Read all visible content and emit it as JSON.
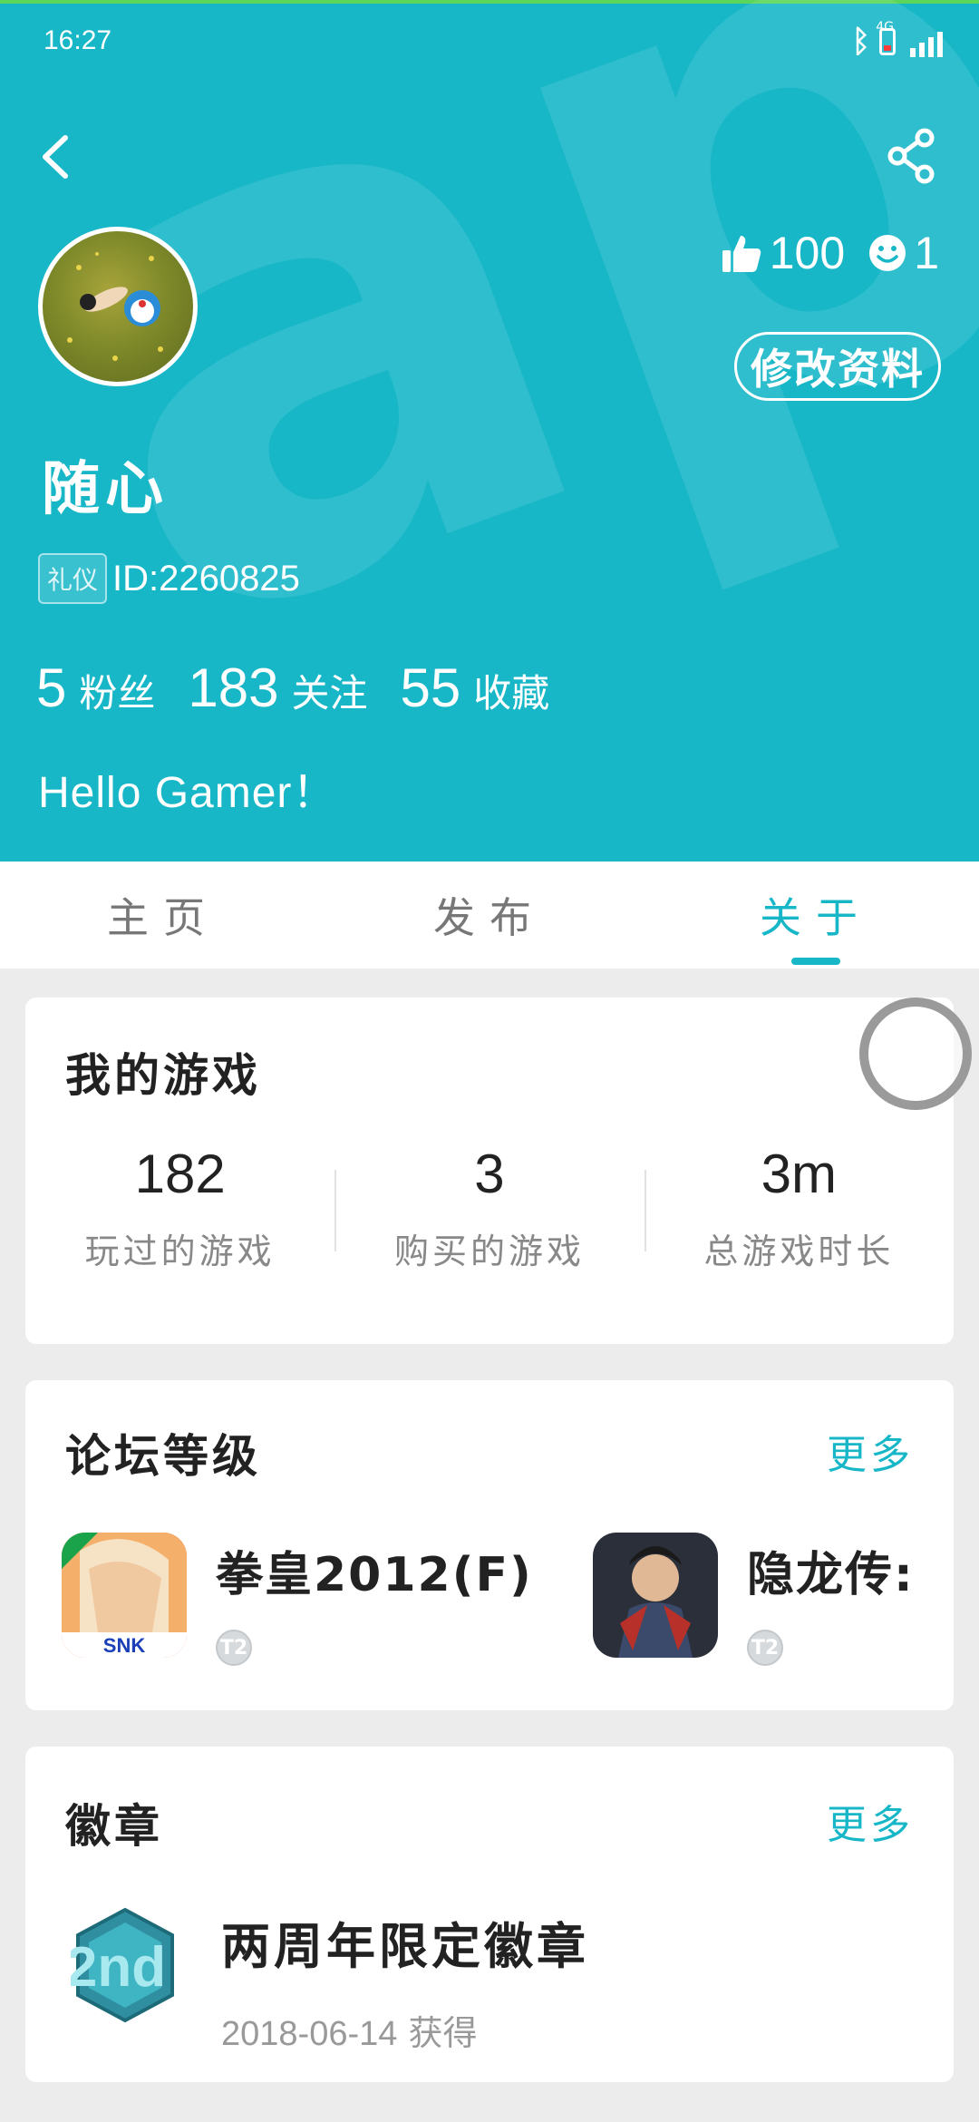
{
  "status_bar": {
    "time": "16:27",
    "network": "4G"
  },
  "profile": {
    "username": "随心",
    "tag": "礼仪",
    "id_text": "ID:2260825",
    "likes": "100",
    "smiles": "1",
    "edit_label": "修改资料",
    "bio": "Hello Gamer！"
  },
  "counts": [
    {
      "num": "5",
      "label": "粉丝"
    },
    {
      "num": "183",
      "label": "关注"
    },
    {
      "num": "55",
      "label": "收藏"
    }
  ],
  "tabs": [
    {
      "label": "主页",
      "active": false
    },
    {
      "label": "发布",
      "active": false
    },
    {
      "label": "关于",
      "active": true
    }
  ],
  "my_games": {
    "title": "我的游戏",
    "stats": [
      {
        "num": "182",
        "label": "玩过的游戏"
      },
      {
        "num": "3",
        "label": "购买的游戏"
      },
      {
        "num": "3m",
        "label": "总游戏时长"
      }
    ]
  },
  "forum": {
    "title": "论坛等级",
    "more": "更多",
    "items": [
      {
        "name": "拳皇2012(F)",
        "icon": "kof-game-icon",
        "level": "T2"
      },
      {
        "name": "隐龙传:",
        "icon": "dragon-game-icon",
        "level": "T2"
      }
    ]
  },
  "badges": {
    "title": "徽章",
    "more": "更多",
    "items": [
      {
        "name": "两周年限定徽章",
        "date": "2018-06-14",
        "suffix": "获得",
        "icon_text": "2nd"
      }
    ]
  },
  "colors": {
    "accent": "#18b7c8",
    "background": "#ececec"
  }
}
